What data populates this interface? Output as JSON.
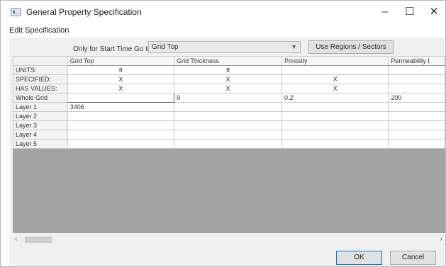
{
  "window": {
    "title": "General Property Specification",
    "minimize": "–",
    "maximize": "☐",
    "close": "✕"
  },
  "menu": {
    "edit_specification": "Edit Specification"
  },
  "toolbar": {
    "goto_label": "Only for Start Time Go to",
    "goto_value": "Grid Top",
    "regions_button": "Use Regions / Sectors"
  },
  "table": {
    "columns": [
      "Grid Top",
      "Grid Thickness",
      "Porosity",
      "Permeability I"
    ],
    "units": [
      "ft",
      "ft",
      "",
      ""
    ],
    "specified": [
      "X",
      "X",
      "X",
      ""
    ],
    "has_values": [
      "X",
      "X",
      "X",
      ""
    ],
    "rows": [
      {
        "label": "Whole Grid",
        "values": [
          "",
          "9",
          "0.2",
          "200"
        ]
      },
      {
        "label": "Layer 1",
        "values": [
          "3406",
          "",
          "",
          ""
        ]
      },
      {
        "label": "Layer 2",
        "values": [
          "",
          "",
          "",
          ""
        ]
      },
      {
        "label": "Layer 3",
        "values": [
          "",
          "",
          "",
          ""
        ]
      },
      {
        "label": "Layer 4",
        "values": [
          "",
          "",
          "",
          ""
        ]
      },
      {
        "label": "Layer 5",
        "values": [
          "",
          "",
          "",
          ""
        ]
      }
    ],
    "units_label": "UNITS:",
    "specified_label": "SPECIFIED:",
    "has_values_label": "HAS VALUES:"
  },
  "buttons": {
    "ok": "OK",
    "cancel": "Cancel"
  },
  "scrollbar": {
    "left": "‹",
    "right": "›"
  }
}
